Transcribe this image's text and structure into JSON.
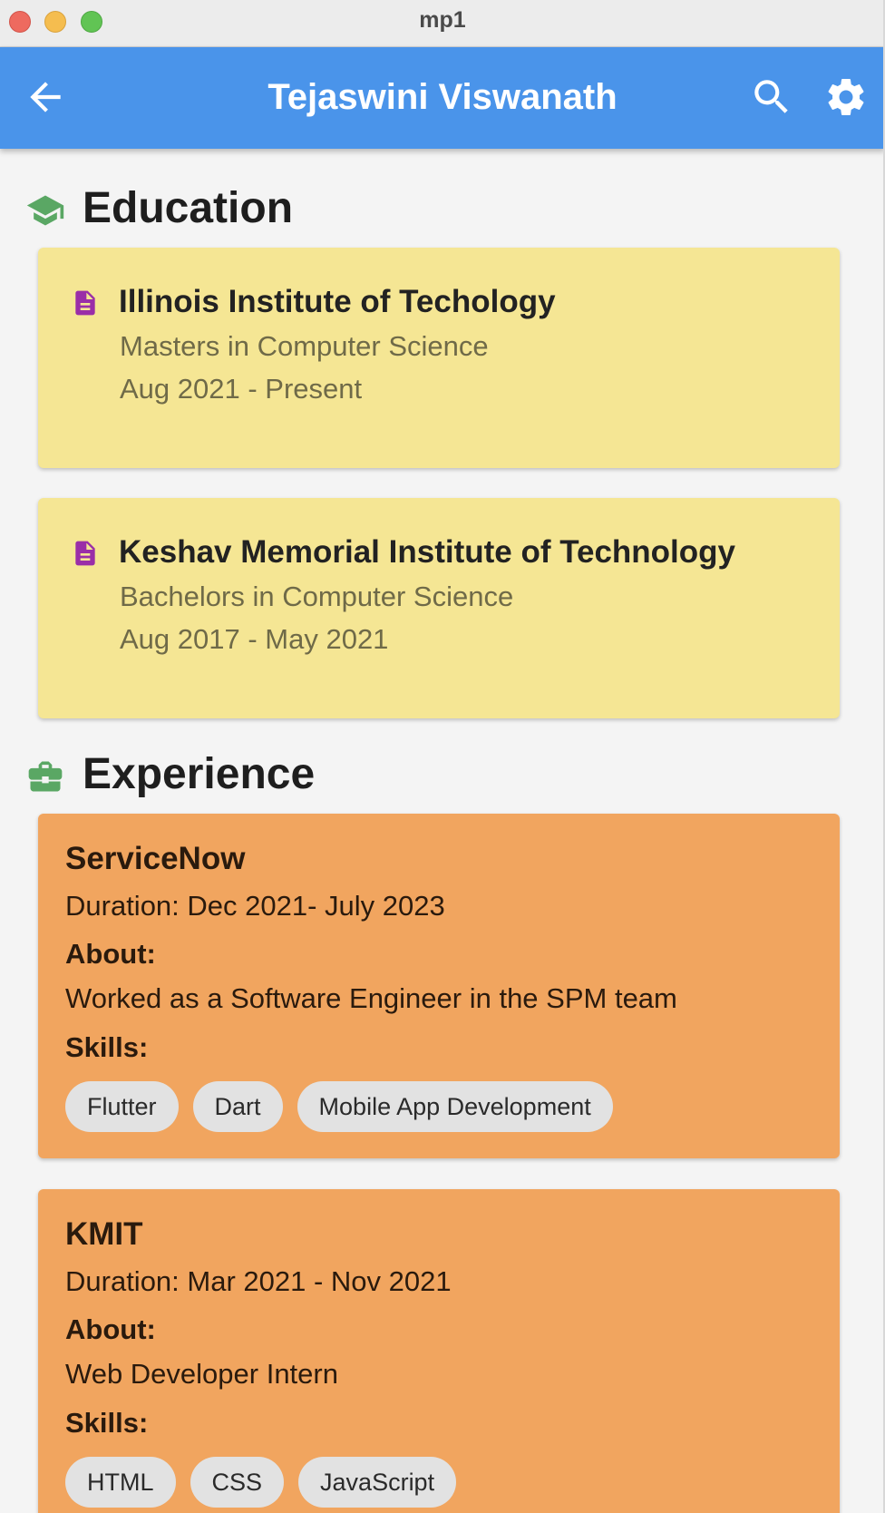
{
  "window": {
    "title": "mp1"
  },
  "appbar": {
    "title": "Tejaswini Viswanath",
    "back_icon": "arrow-back-icon",
    "search_icon": "search-icon",
    "settings_icon": "gear-icon",
    "color": "#4a94ea"
  },
  "education": {
    "heading": "Education",
    "icon": "graduation-cap-icon",
    "items": [
      {
        "school": "Illinois Institute of Techology",
        "degree": "Masters in Computer Science",
        "dates": "Aug 2021 - Present"
      },
      {
        "school": "Keshav Memorial Institute of Technology",
        "degree": "Bachelors in Computer Science",
        "dates": "Aug 2017 - May 2021"
      }
    ],
    "card_color": "#f5e694"
  },
  "experience": {
    "heading": "Experience",
    "icon": "briefcase-icon",
    "card_color": "#f1a55f",
    "items": [
      {
        "company": "ServiceNow",
        "duration": "Duration: Dec 2021- July 2023",
        "about_label": "About:",
        "about": "Worked as a Software Engineer in the SPM team",
        "skills_label": "Skills:",
        "skills": [
          "Flutter",
          "Dart",
          "Mobile App Development"
        ]
      },
      {
        "company": "KMIT",
        "duration": "Duration: Mar 2021 - Nov 2021",
        "about_label": "About:",
        "about": "Web Developer Intern",
        "skills_label": "Skills:",
        "skills": [
          "HTML",
          "CSS",
          "JavaScript"
        ]
      }
    ]
  }
}
